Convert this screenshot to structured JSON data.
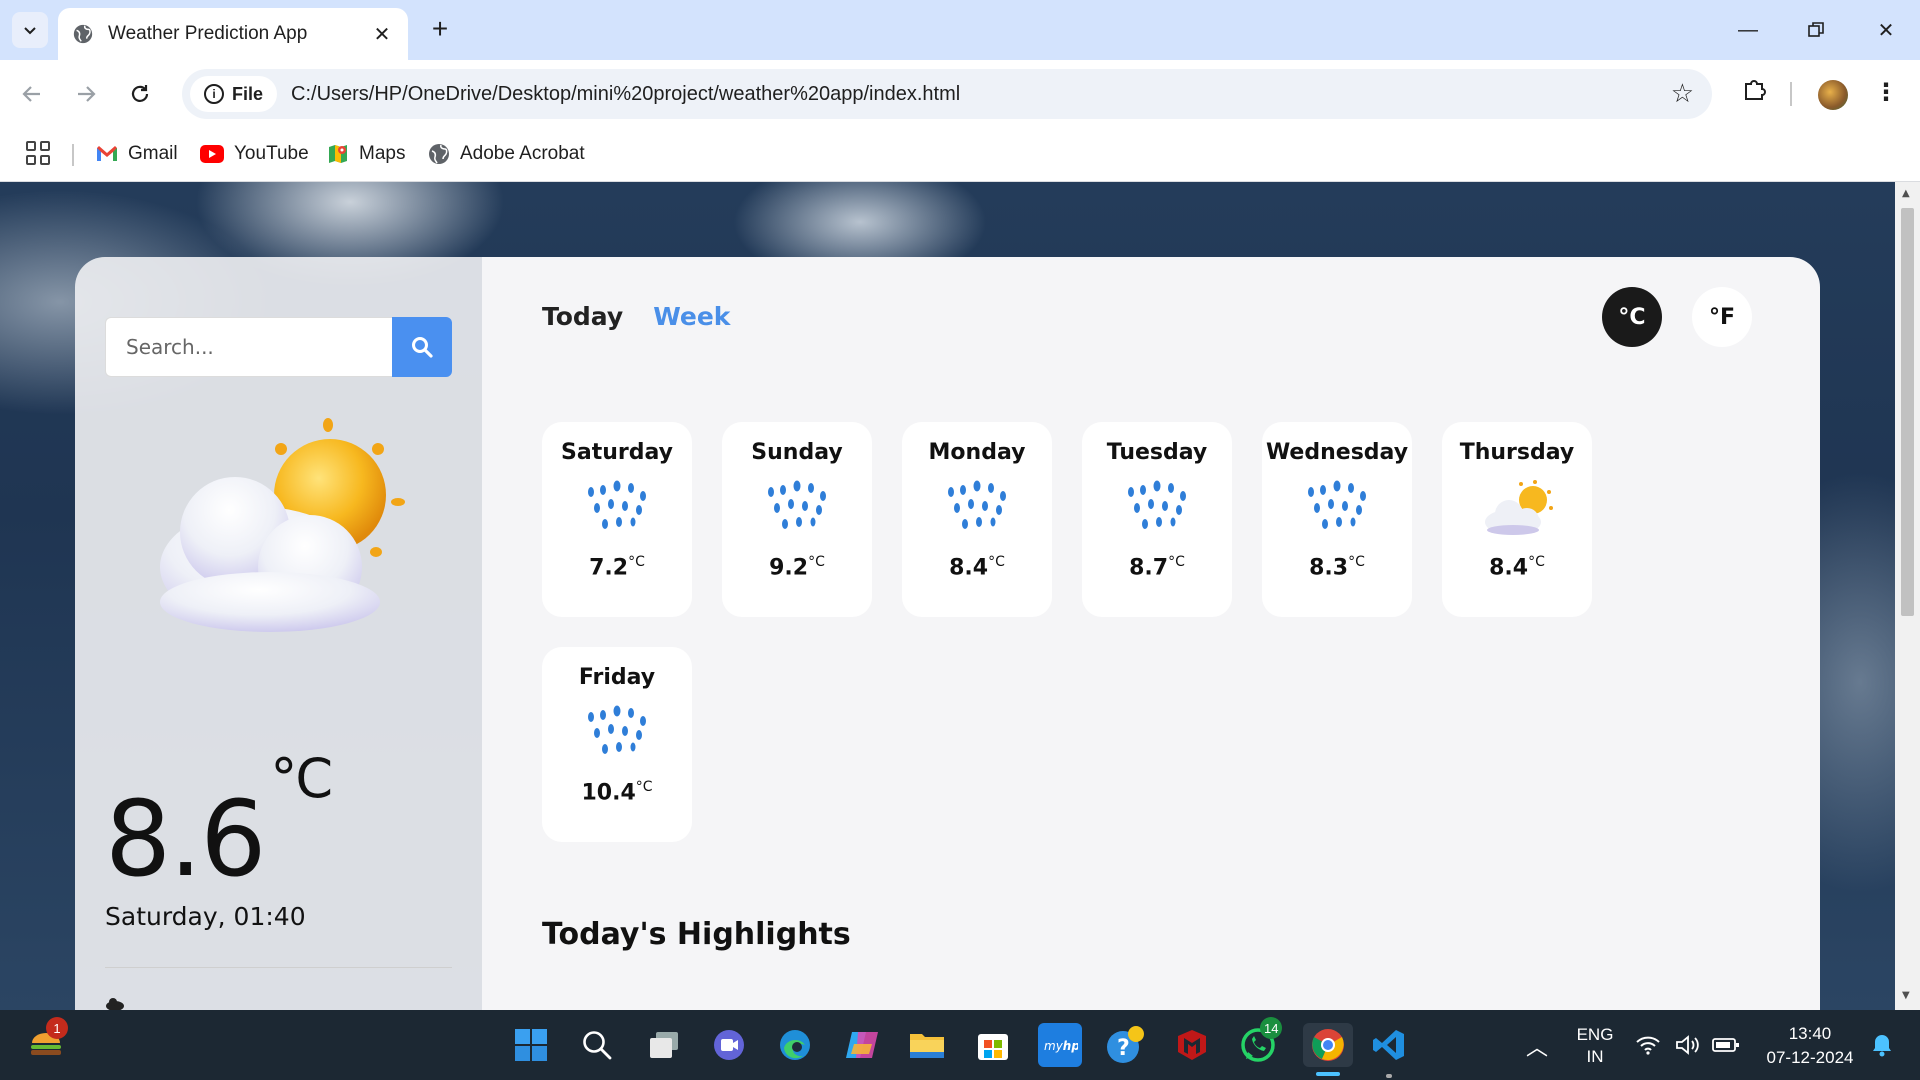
{
  "browser": {
    "tab_title": "Weather Prediction App",
    "file_chip": "File",
    "url": "C:/Users/HP/OneDrive/Desktop/mini%20project/weather%20app/index.html",
    "bookmarks": [
      {
        "label": "Gmail",
        "icon": "gmail-icon"
      },
      {
        "label": "YouTube",
        "icon": "youtube-icon"
      },
      {
        "label": "Maps",
        "icon": "maps-icon"
      },
      {
        "label": "Adobe Acrobat",
        "icon": "globe-icon"
      }
    ]
  },
  "app": {
    "search_placeholder": "Search...",
    "current": {
      "temp": "8.6",
      "unit": "°C",
      "datetime": "Saturday, 01:40",
      "icon": "partly-cloudy-icon"
    },
    "tabs": {
      "today": "Today",
      "week": "Week"
    },
    "units": {
      "celsius": "°C",
      "fahrenheit": "°F"
    },
    "forecast": [
      {
        "day": "Saturday",
        "temp": "7.2",
        "unit": "°C",
        "icon": "rain-icon"
      },
      {
        "day": "Sunday",
        "temp": "9.2",
        "unit": "°C",
        "icon": "rain-icon"
      },
      {
        "day": "Monday",
        "temp": "8.4",
        "unit": "°C",
        "icon": "rain-icon"
      },
      {
        "day": "Tuesday",
        "temp": "8.7",
        "unit": "°C",
        "icon": "rain-icon"
      },
      {
        "day": "Wednesday",
        "temp": "8.3",
        "unit": "°C",
        "icon": "rain-icon"
      },
      {
        "day": "Thursday",
        "temp": "8.4",
        "unit": "°C",
        "icon": "partly-cloudy-icon"
      },
      {
        "day": "Friday",
        "temp": "10.4",
        "unit": "°C",
        "icon": "rain-icon"
      }
    ],
    "highlights_title": "Today's Highlights"
  },
  "taskbar": {
    "lang_top": "ENG",
    "lang_bottom": "IN",
    "time": "13:40",
    "date": "07-12-2024",
    "widget_badge": "1",
    "whatsapp_badge": "14"
  }
}
